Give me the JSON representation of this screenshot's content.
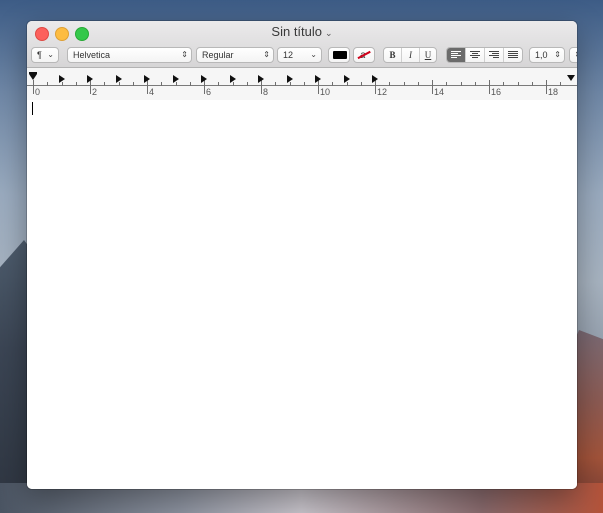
{
  "window": {
    "title": "Sin título"
  },
  "toolbar": {
    "paragraph_symbol": "¶",
    "font_family": "Helvetica",
    "font_style": "Regular",
    "font_size": "12",
    "bold_label": "B",
    "italic_label": "I",
    "underline_label": "U",
    "line_spacing": "1,0",
    "text_color": "#000000",
    "alignment_selected": "left"
  },
  "ruler": {
    "labels": [
      "0",
      "2",
      "4",
      "6",
      "8",
      "10",
      "12",
      "14",
      "16",
      "18"
    ]
  },
  "icons": {
    "close": "close-button",
    "minimize": "minimize-button",
    "zoom": "zoom-button",
    "title_menu": "chevron-down-icon"
  }
}
